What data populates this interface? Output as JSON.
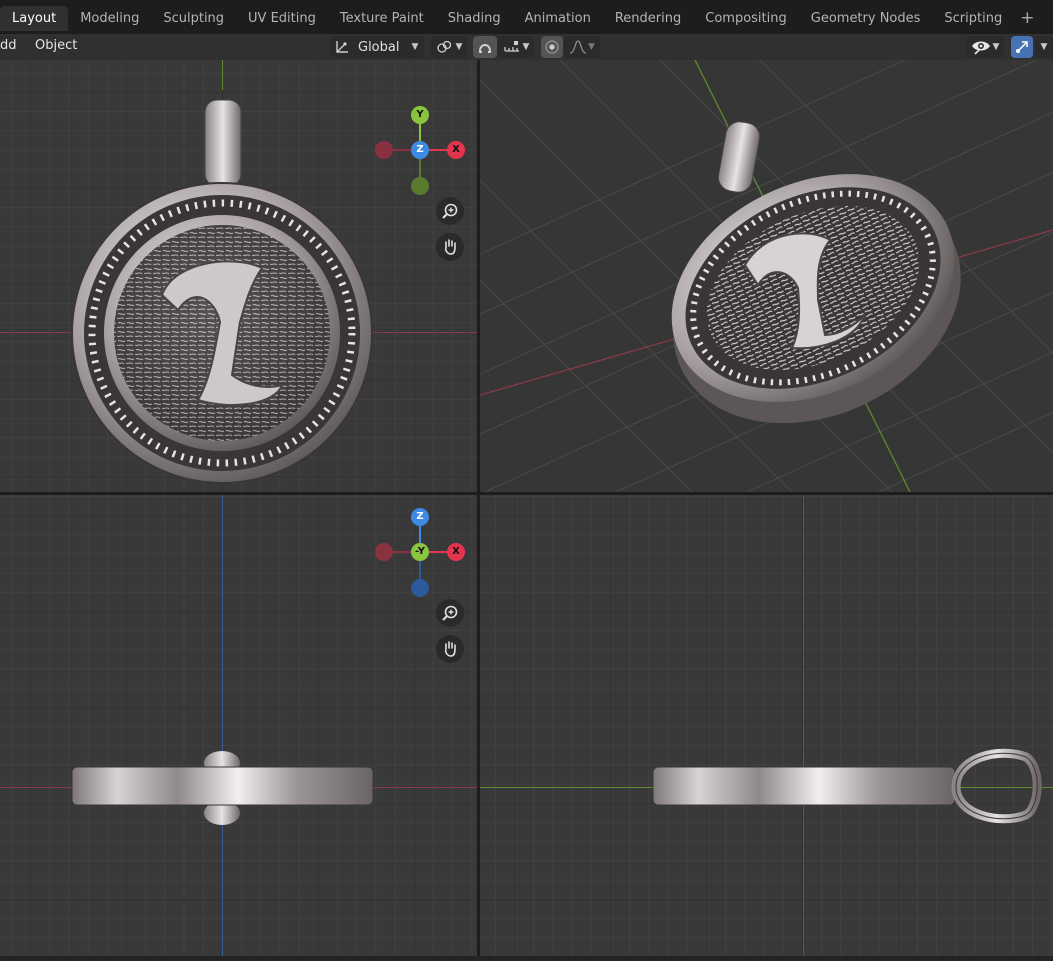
{
  "workspace_tabs": [
    "Layout",
    "Modeling",
    "Sculpting",
    "UV Editing",
    "Texture Paint",
    "Shading",
    "Animation",
    "Rendering",
    "Compositing",
    "Geometry Nodes",
    "Scripting"
  ],
  "add_workspace": "+",
  "header": {
    "menu_add": "dd",
    "menu_object": "Object",
    "transform_orientation": "Global"
  },
  "gizmo_top": {
    "y": "Y",
    "z": "Z",
    "x": "X"
  },
  "gizmo_front": {
    "z": "Z",
    "y": "-Y",
    "x": "X"
  },
  "colors": {
    "x_axis": "#e3364e",
    "y_axis": "#8bc43d",
    "z_axis": "#3d8ae5",
    "active_blue": "#4772b3"
  },
  "icons": [
    "transform-pivot-icon",
    "snap-icon",
    "proportional-edit-icon",
    "zoom-icon",
    "pan-hand-icon",
    "visibility-eye-icon",
    "gizmo-toggle-icon"
  ]
}
